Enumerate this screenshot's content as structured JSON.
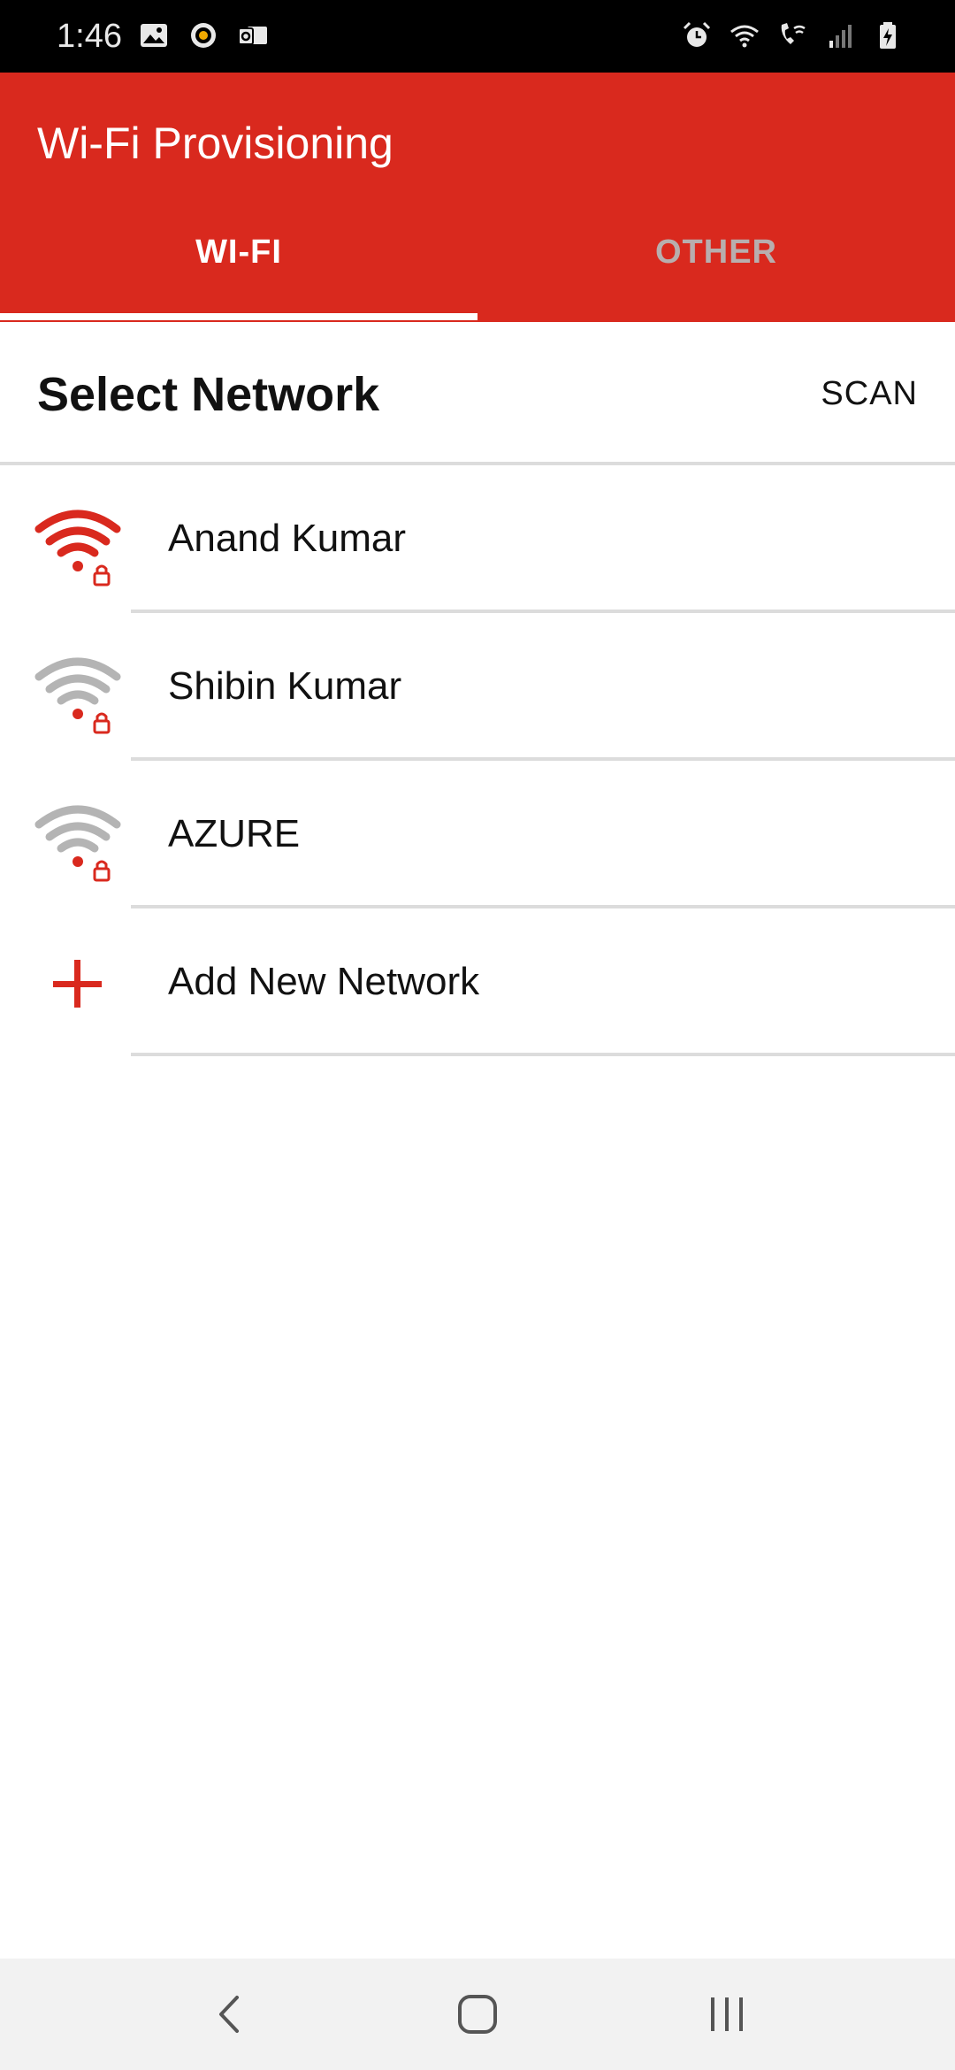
{
  "status_bar": {
    "time": "1:46",
    "left_icons": [
      "image-icon",
      "gauge-icon",
      "outlook-icon"
    ],
    "right_icons": [
      "alarm-icon",
      "wifi-icon",
      "wifi-calling-icon",
      "signal-icon",
      "battery-icon"
    ]
  },
  "app_bar": {
    "title": "Wi-Fi Provisioning",
    "tabs": [
      {
        "label": "WI-FI",
        "selected": true
      },
      {
        "label": "OTHER",
        "selected": false
      }
    ]
  },
  "section": {
    "title": "Select Network",
    "scan_label": "SCAN"
  },
  "networks": [
    {
      "name": "Anand Kumar",
      "icon": "wifi-locked-icon",
      "color": "#d9291e"
    },
    {
      "name": "Shibin Kumar",
      "icon": "wifi-locked-icon",
      "color": "#b4b4b4"
    },
    {
      "name": "AZURE",
      "icon": "wifi-locked-icon",
      "color": "#b4b4b4"
    }
  ],
  "add_network": {
    "label": "Add New Network",
    "icon": "plus-icon"
  },
  "nav_bar": {
    "buttons": [
      "back-icon",
      "home-icon",
      "recents-icon"
    ]
  },
  "colors": {
    "accent": "#d9291e",
    "inactive_wifi": "#b4b4b4",
    "divider": "#dcdcdc"
  }
}
